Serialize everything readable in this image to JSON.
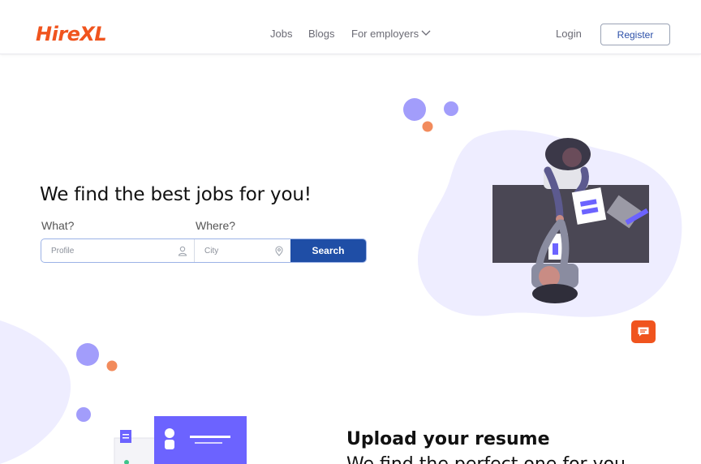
{
  "header": {
    "logo": "HireXL",
    "nav": {
      "jobs": "Jobs",
      "blogs": "Blogs",
      "employers": "For employers"
    },
    "login": "Login",
    "register": "Register"
  },
  "hero": {
    "title": "We find the best jobs for you!",
    "what_label": "What?",
    "where_label": "Where?",
    "profile_placeholder": "Profile",
    "city_placeholder": "City",
    "search_label": "Search"
  },
  "resume_section": {
    "title": "Upload your resume",
    "subtitle": "We find the perfect one for you"
  },
  "icons": {
    "chevron": "chevron-down-icon",
    "profile": "user-icon",
    "city": "location-pin-icon",
    "chat": "chat-icon"
  },
  "colors": {
    "brand": "#f0541e",
    "primary": "#1f4ea6",
    "accent_purple": "#6c63ff",
    "blob": "#eeedff"
  }
}
